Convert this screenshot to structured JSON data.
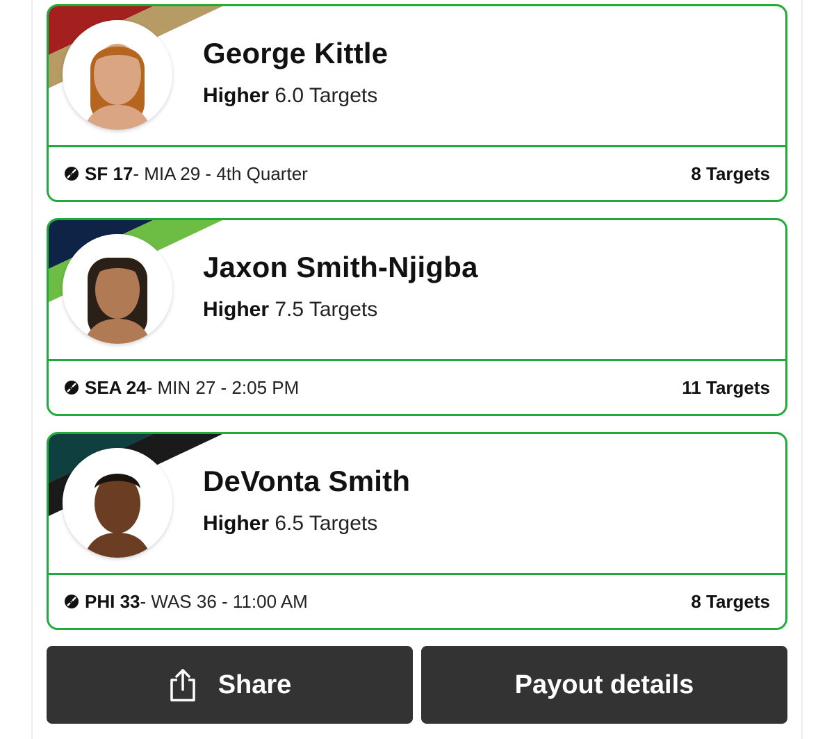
{
  "picks": [
    {
      "player_name": "George Kittle",
      "direction": "Higher",
      "line": "6.0 Targets",
      "team": "SF 17",
      "game_rest": " - MIA 29 - 4th Quarter",
      "result": "8 Targets",
      "team_colors": [
        "#a3201f",
        "#b69b65"
      ],
      "skin_color": "#d9a583",
      "hair_color": "#b5651d"
    },
    {
      "player_name": "Jaxon Smith-Njigba",
      "direction": "Higher",
      "line": "7.5 Targets",
      "team": "SEA 24",
      "game_rest": " - MIN 27 - 2:05 PM",
      "result": "11 Targets",
      "team_colors": [
        "#0f2346",
        "#6dbd45"
      ],
      "skin_color": "#b07a55",
      "hair_color": "#2a2018"
    },
    {
      "player_name": "DeVonta Smith",
      "direction": "Higher",
      "line": "6.5 Targets",
      "team": "PHI 33",
      "game_rest": " - WAS 36 - 11:00 AM",
      "result": "8 Targets",
      "team_colors": [
        "#0f3f3f",
        "#1a1a1a"
      ],
      "skin_color": "#6b3e24",
      "hair_color": "#1a120c"
    }
  ],
  "buttons": {
    "share_label": "Share",
    "payout_label": "Payout details"
  },
  "icons": {
    "game": "football-icon",
    "share": "share-icon",
    "avatar": "player-headshot"
  }
}
